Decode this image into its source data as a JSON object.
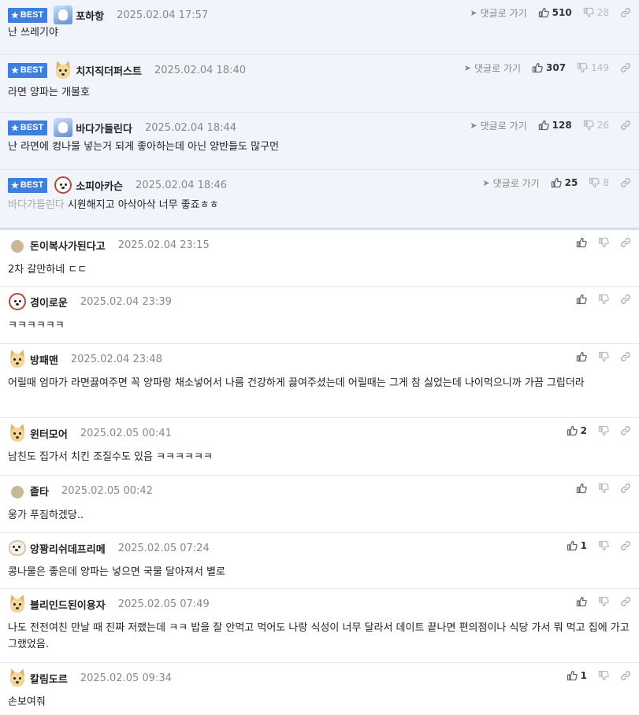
{
  "best_label": "BEST",
  "reply_label": "댓글로 가기",
  "colors": {
    "badge": "#3d7fe0",
    "best_bg": "#f1f4fb"
  },
  "comments": [
    {
      "best": true,
      "avatar": "ice",
      "nick": "포하항",
      "date": "2025.02.04 17:57",
      "up": "510",
      "down": "28",
      "mention": "",
      "text": "난 쓰레기야"
    },
    {
      "best": true,
      "avatar": "dog",
      "nick": "치지직더퍼스트",
      "date": "2025.02.04 18:40",
      "up": "307",
      "down": "149",
      "mention": "",
      "text": "라면 양파는 개볼호"
    },
    {
      "best": true,
      "avatar": "ice",
      "nick": "바다가들린다",
      "date": "2025.02.04 18:44",
      "up": "128",
      "down": "26",
      "mention": "",
      "text": "난 라면에 컹나물 넣는거 되게 좋아하는데 아닌 양반들도 많구먼"
    },
    {
      "best": true,
      "avatar": "poodle",
      "nick": "소피아카슨",
      "date": "2025.02.04 18:46",
      "up": "25",
      "down": "8",
      "mention": "바다가들린다",
      "text": "시원해지고 아삭아삭 너무 좋죠ㅎㅎ"
    },
    {
      "best": false,
      "avatar": "dot",
      "nick": "돈이복사가된다고",
      "date": "2025.02.04 23:15",
      "up": "",
      "down": "",
      "mention": "",
      "text": "2차 갈만하네 ㄷㄷ"
    },
    {
      "best": false,
      "avatar": "poodle",
      "nick": "경이로운",
      "date": "2025.02.04 23:39",
      "up": "",
      "down": "",
      "mention": "",
      "text": "ㅋㅋㅋㅋㅋㅋ"
    },
    {
      "best": false,
      "avatar": "dog",
      "nick": "방패맨",
      "date": "2025.02.04 23:48",
      "up": "",
      "down": "",
      "mention": "",
      "text": "어릴때 엄마가 라면끓여주면 꼭 양파랑 채소넣어서 나름 건강하게 끓여주셨는데 어릴때는 그게 참 싫었는데 나이먹으니까 가끔 그립더라"
    },
    {
      "best": false,
      "avatar": "dog",
      "nick": "윈터모어",
      "date": "2025.02.05 00:41",
      "up": "2",
      "down": "",
      "mention": "",
      "text": "남친도 집가서 치킨 조질수도 있음 ㅋㅋㅋㅋㅋㅋ"
    },
    {
      "best": false,
      "avatar": "dot",
      "nick": "좉타",
      "date": "2025.02.05 00:42",
      "up": "",
      "down": "",
      "mention": "",
      "text": "웅가 푸짐하겠당.."
    },
    {
      "best": false,
      "avatar": "shih",
      "nick": "앙꽝리쉬데프리메",
      "date": "2025.02.05 07:24",
      "up": "1",
      "down": "",
      "mention": "",
      "text": "콩나물은 좋은데 양파는 넣으면 국물 달아져서 별로"
    },
    {
      "best": false,
      "avatar": "dog",
      "nick": "블리인드된이용자",
      "date": "2025.02.05 07:49",
      "up": "",
      "down": "",
      "mention": "",
      "text": "나도 전전여친 만날 때 진짜 저랬는데 ㅋㅋ 밥을 잘 안먹고 먹어도 나랑 식성이 너무 달라서 데이트 끝나면 편의점이나 식당 가서 뭐 먹고 집에 가고 그랬었음."
    },
    {
      "best": false,
      "avatar": "dog",
      "nick": "칼림도르",
      "date": "2025.02.05 09:34",
      "up": "1",
      "down": "",
      "mention": "",
      "text": "손보여줘"
    }
  ]
}
